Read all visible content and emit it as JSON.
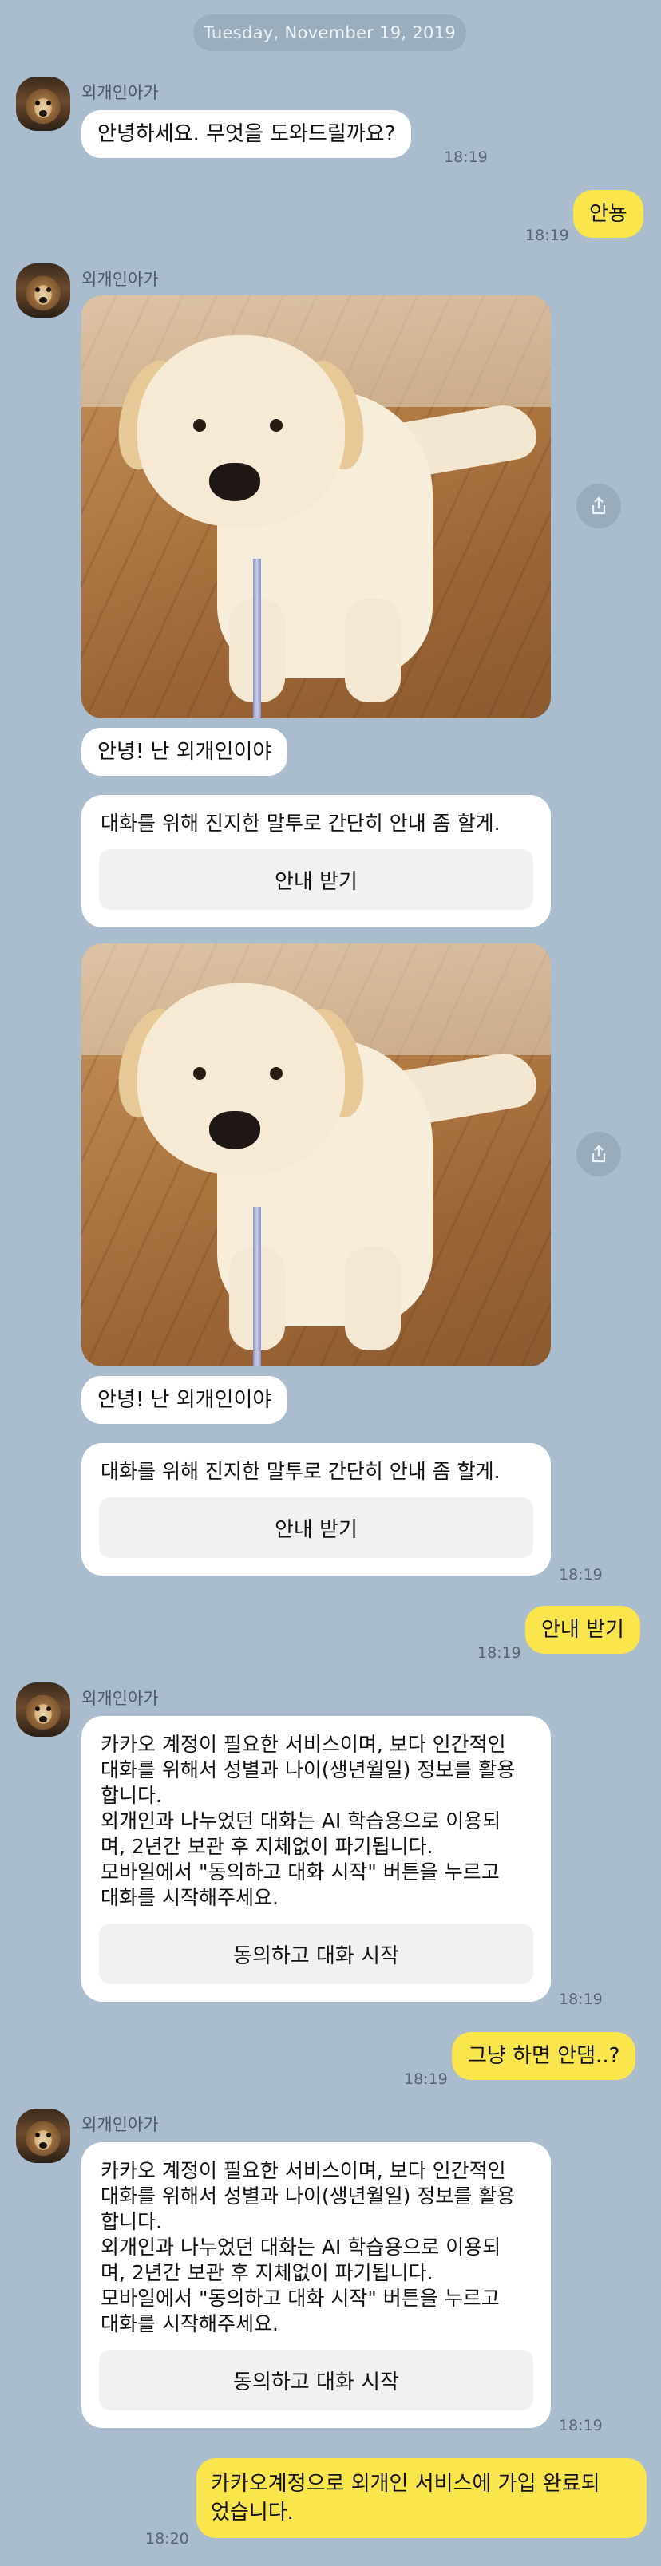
{
  "date_divider": "Tuesday, November 19, 2019",
  "colors": {
    "background": "#a9bdce",
    "outgoing_bubble": "#fbe54d",
    "incoming_bubble": "#ffffff"
  },
  "sender_name": "외개인아가",
  "messages": {
    "m1": {
      "text": "안녕하세요. 무엇을 도와드릴까요?",
      "time": "18:19"
    },
    "m2": {
      "text": "안뇽",
      "time": "18:19"
    },
    "m3": {
      "greeting": "안녕! 난 외개인이야",
      "card_text": "대화를 위해 진지한 말투로 간단히 안내 좀 할게.",
      "button": "안내 받기"
    },
    "m4": {
      "greeting": "안녕! 난 외개인이야",
      "card_text": "대화를 위해 진지한 말투로 간단히 안내 좀 할게.",
      "button": "안내 받기",
      "time": "18:19"
    },
    "m5": {
      "text": "안내 받기",
      "time": "18:19"
    },
    "m6": {
      "card_text": "카카오 계정이 필요한 서비스이며, 보다 인간적인\n대화를 위해서 성별과 나이(생년월일) 정보를 활용\n합니다.\n외개인과 나누었던 대화는 AI 학습용으로 이용되\n며, 2년간 보관 후 지체없이 파기됩니다.\n모바일에서 \"동의하고 대화 시작\" 버튼을 누르고\n대화를 시작해주세요.",
      "button": "동의하고 대화 시작",
      "time": "18:19"
    },
    "m7": {
      "text": "그냥 하면 안댐..?",
      "time": "18:19"
    },
    "m8": {
      "card_text": "카카오 계정이 필요한 서비스이며, 보다 인간적인\n대화를 위해서 성별과 나이(생년월일) 정보를 활용\n합니다.\n외개인과 나누었던 대화는 AI 학습용으로 이용되\n며, 2년간 보관 후 지체없이 파기됩니다.\n모바일에서 \"동의하고 대화 시작\" 버튼을 누르고\n대화를 시작해주세요.",
      "button": "동의하고 대화 시작",
      "time": "18:19"
    },
    "m9": {
      "text": "카카오계정으로 외개인 서비스에 가입 완료되\n었습니다.",
      "time": "18:20"
    }
  }
}
